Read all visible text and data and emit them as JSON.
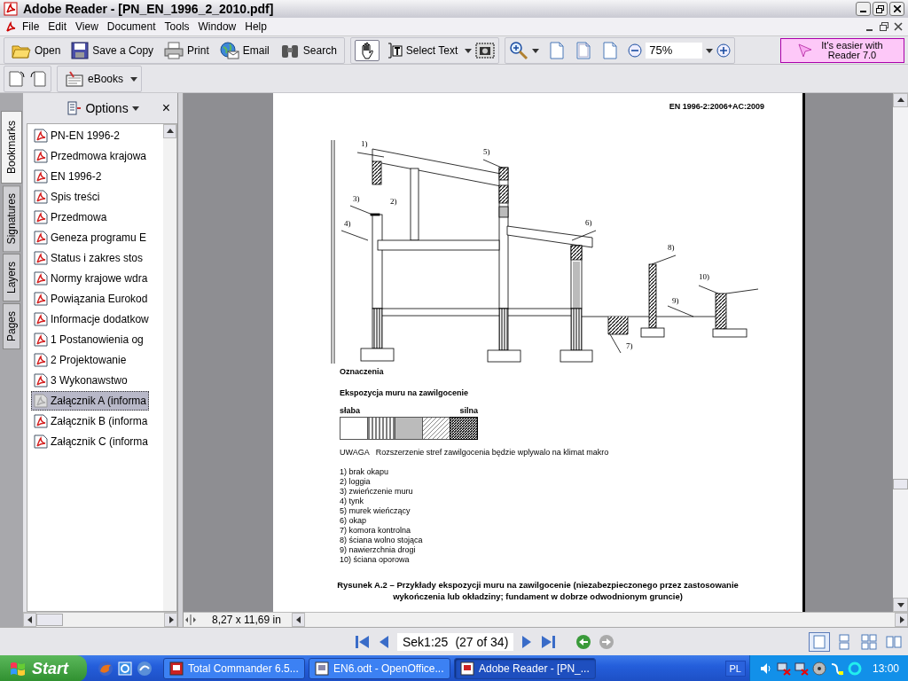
{
  "window": {
    "title": "Adobe Reader - [PN_EN_1996_2_2010.pdf]"
  },
  "menu": [
    "File",
    "Edit",
    "View",
    "Document",
    "Tools",
    "Window",
    "Help"
  ],
  "toolbar": {
    "file_buttons": [
      {
        "label": "Open"
      },
      {
        "label": "Save a Copy"
      },
      {
        "label": "Print"
      },
      {
        "label": "Email"
      },
      {
        "label": "Search"
      }
    ],
    "hand_tool": {
      "selected": true
    },
    "select_text": "Select Text",
    "zoom": "75%",
    "promo": "It's easier with Reader 7.0"
  },
  "toolbar2": {
    "ebooks": "eBooks"
  },
  "side_tabs": [
    {
      "label": "Bookmarks",
      "selected": true
    },
    {
      "label": "Signatures",
      "selected": false
    },
    {
      "label": "Layers",
      "selected": false
    },
    {
      "label": "Pages",
      "selected": false
    }
  ],
  "nav_panel": {
    "options": "Options",
    "close": "×",
    "bookmarks": [
      {
        "label": "PN-EN 1996-2",
        "selected": false
      },
      {
        "label": "Przedmowa krajowa",
        "selected": false
      },
      {
        "label": "EN 1996-2",
        "selected": false
      },
      {
        "label": "Spis treści",
        "selected": false
      },
      {
        "label": "Przedmowa",
        "selected": false
      },
      {
        "label": "Geneza programu E",
        "selected": false
      },
      {
        "label": "Status i zakres stos",
        "selected": false
      },
      {
        "label": "Normy krajowe wdra",
        "selected": false
      },
      {
        "label": "Powiązania Eurokod",
        "selected": false
      },
      {
        "label": "Informacje dodatkow",
        "selected": false
      },
      {
        "label": "1 Postanowienia og",
        "selected": false
      },
      {
        "label": "2 Projektowanie",
        "selected": false
      },
      {
        "label": "3 Wykonawstwo",
        "selected": false
      },
      {
        "label": "Załącznik A (informa",
        "selected": true
      },
      {
        "label": "Załącznik B (informa",
        "selected": false
      },
      {
        "label": "Załącznik C (informa",
        "selected": false
      }
    ]
  },
  "document": {
    "header": "EN 1996-2:2006+AC:2009",
    "callouts": [
      "1)",
      "2)",
      "3)",
      "4)",
      "5)",
      "6)",
      "7)",
      "8)",
      "9)",
      "10)"
    ],
    "legend_title": "Oznaczenia",
    "scale_title": "Ekspozycja muru na zawilgocenie",
    "scale_low": "słaba",
    "scale_high": "silna",
    "note": "UWAGA   Rozszerzenie stref zawilgocenia będzie wplywalo na klimat makro",
    "items": [
      "1) brak okapu",
      "2) loggia",
      "3) zwieńczenie muru",
      "4) tynk",
      "5) murek wieńczący",
      "6) okap",
      "7) komora kontrolna",
      "8) ściana wolno stojąca",
      "9) nawierzchnia drogi",
      "10) ściana oporowa"
    ],
    "caption": "Rysunek A.2 – Przykłady ekspozycji muru na zawilgocenie (niezabezpieczonego przez zastosowanie wykończenia lub okładziny; fundament w dobrze odwodnionym gruncie)"
  },
  "page_size": "8,27 x 11,69 in",
  "navigation": {
    "page": "Sek1:25",
    "count": "(27 of 34)",
    "views": [
      {
        "selected": true
      },
      {
        "selected": false
      },
      {
        "selected": false
      },
      {
        "selected": false
      }
    ]
  },
  "taskbar": {
    "start": "Start",
    "tasks": [
      {
        "label": "Total Commander 6.5...",
        "selected": false
      },
      {
        "label": "EN6.odt - OpenOffice...",
        "selected": false
      },
      {
        "label": "Adobe Reader - [PN_...",
        "selected": true
      }
    ],
    "language": "PL",
    "clock": "13:00"
  }
}
